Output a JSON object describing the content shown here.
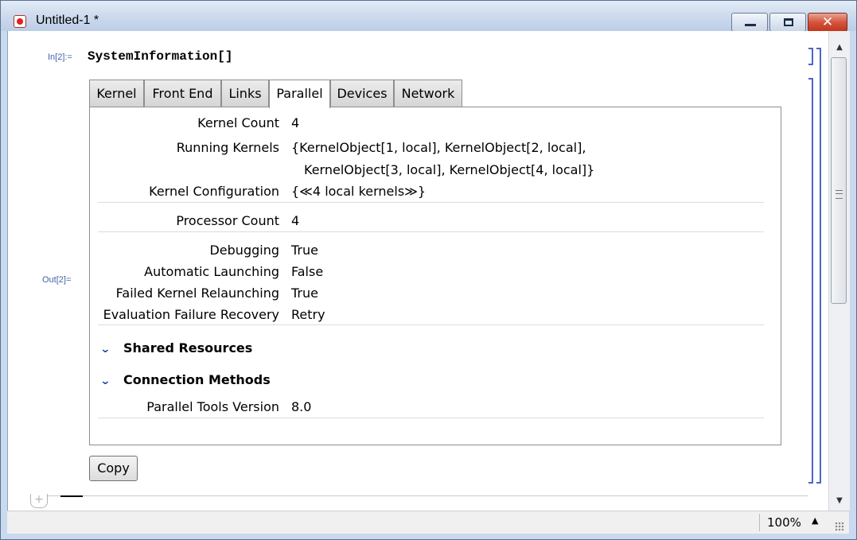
{
  "window": {
    "title": "Untitled-1 *",
    "close_glyph": "✕"
  },
  "cell": {
    "in_label": "In[2]:=",
    "input": "SystemInformation[]",
    "out_label": "Out[2]="
  },
  "tabs": [
    {
      "label": "Kernel"
    },
    {
      "label": "Front End"
    },
    {
      "label": "Links"
    },
    {
      "label": "Parallel",
      "active": true
    },
    {
      "label": "Devices"
    },
    {
      "label": "Network"
    }
  ],
  "parallel": {
    "kernel_count": {
      "label": "Kernel Count",
      "value": "4"
    },
    "running_kernels": {
      "label": "Running Kernels",
      "line1": "{KernelObject[1, local], KernelObject[2, local],",
      "line2": "KernelObject[3, local], KernelObject[4, local]}"
    },
    "kernel_configuration": {
      "label": "Kernel Configuration",
      "value": "{≪4 local kernels≫}"
    },
    "processor_count": {
      "label": "Processor Count",
      "value": "4"
    },
    "debugging": {
      "label": "Debugging",
      "value": "True"
    },
    "automatic_launching": {
      "label": "Automatic Launching",
      "value": "False"
    },
    "failed_kernel_relaunching": {
      "label": "Failed Kernel Relaunching",
      "value": "True"
    },
    "evaluation_failure_recovery": {
      "label": "Evaluation Failure Recovery",
      "value": "Retry"
    },
    "shared_resources": "Shared Resources",
    "connection_methods": "Connection Methods",
    "parallel_tools_version": {
      "label": "Parallel Tools Version",
      "value": "8.0"
    }
  },
  "copy_button": "Copy",
  "status": {
    "zoom": "100%"
  },
  "icons": {
    "chevron": "chevron-down-icon",
    "accent": "#4c66c7"
  }
}
